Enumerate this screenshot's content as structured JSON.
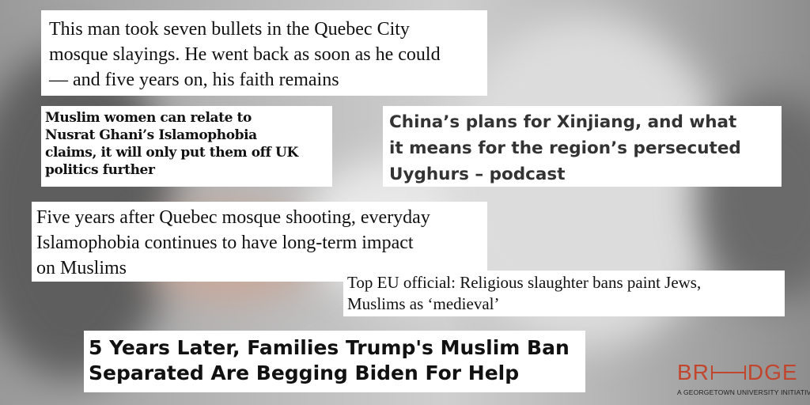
{
  "headlines": [
    {
      "lines": [
        "This man took seven bullets in the Quebec City",
        "mosque slayings. He went back as soon as he could",
        "— and five years on, his faith remains"
      ]
    },
    {
      "lines": [
        "Muslim women can relate to",
        "Nusrat Ghani’s Islamophobia",
        "claims, it will only put them off UK",
        "politics further"
      ]
    },
    {
      "lines": [
        "China’s plans for Xinjiang, and what",
        "it means for the region’s persecuted",
        "Uyghurs – podcast"
      ]
    },
    {
      "lines": [
        "Five years after Quebec mosque shooting, everyday",
        "Islamophobia continues to have long-term impact",
        "on Muslims"
      ]
    },
    {
      "lines": [
        "Top EU official: Religious slaughter bans paint Jews,",
        "Muslims as ‘medieval’"
      ]
    },
    {
      "lines": [
        "5 Years Later, Families Trump's Muslim Ban",
        "Separated Are Begging Biden For Help"
      ]
    }
  ],
  "logo": {
    "left": "BR",
    "right": "DGE",
    "tagline": "A GEORGETOWN UNIVERSITY INITIATIVE",
    "color": "#c2452d"
  },
  "colors": {
    "clip_background": "#ffffff",
    "headline_text": "#111111"
  }
}
